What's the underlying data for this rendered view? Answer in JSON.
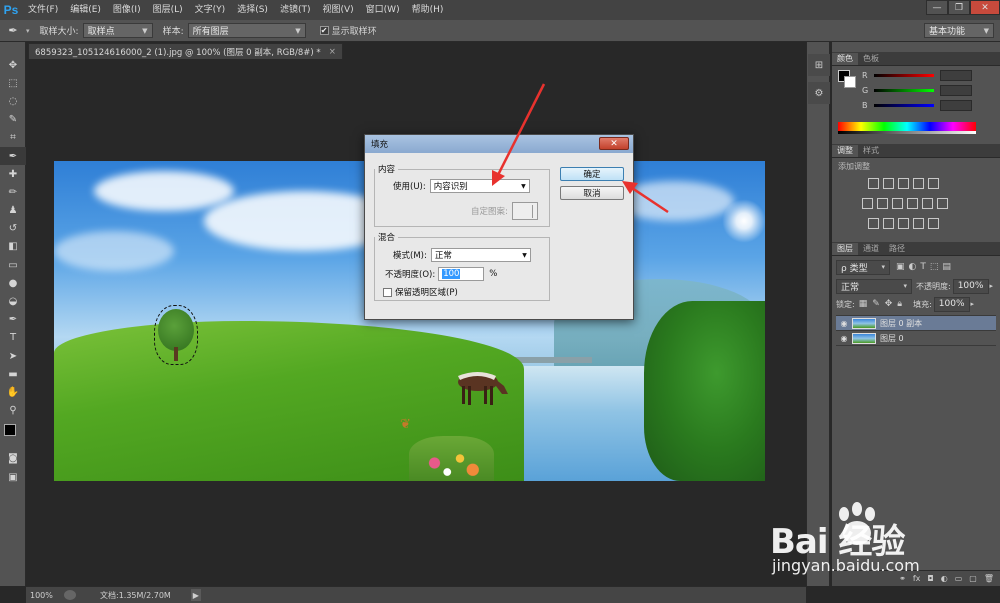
{
  "app": {
    "logo": "Ps",
    "menu": [
      "文件(F)",
      "编辑(E)",
      "图像(I)",
      "图层(L)",
      "文字(Y)",
      "选择(S)",
      "滤镜(T)",
      "视图(V)",
      "窗口(W)",
      "帮助(H)"
    ],
    "window_buttons": [
      "—",
      "❐",
      "✕"
    ]
  },
  "options": {
    "sample_size_label": "取样大小:",
    "sample_size_value": "取样点",
    "sample_label": "样本:",
    "sample_value": "所有图层",
    "show_ring_label": "显示取样环",
    "workspace": "基本功能"
  },
  "document": {
    "tab_title": "6859323_105124616000_2 (1).jpg @ 100% (图层 0 副本, RGB/8#) *",
    "tab_close": "×"
  },
  "status": {
    "zoom": "100%",
    "doc_info": "文档:1.35M/2.70M"
  },
  "panels": {
    "color_tabs": [
      "颜色",
      "色板"
    ],
    "channels": [
      "R",
      "G",
      "B"
    ],
    "adjust_tabs": [
      "调整",
      "样式"
    ],
    "adjust_title": "添加调整",
    "layer_tabs": [
      "图层",
      "通道",
      "路径"
    ],
    "filter_kind": "ρ 类型",
    "blend_mode": "正常",
    "opacity_label": "不透明度:",
    "opacity_value": "100%",
    "lock_label": "锁定:",
    "fill_label": "填充:",
    "fill_value": "100%",
    "layers": [
      {
        "name": "图层 0 副本",
        "active": true
      },
      {
        "name": "图层 0",
        "active": false
      }
    ]
  },
  "dialog": {
    "title": "填充",
    "close": "✕",
    "content_group": "内容",
    "use_label": "使用(U):",
    "use_value": "内容识别",
    "custom_pattern_label": "自定图案:",
    "blend_group": "混合",
    "mode_label": "模式(M):",
    "mode_value": "正常",
    "opacity_label": "不透明度(O):",
    "opacity_value": "100",
    "opacity_unit": "%",
    "preserve_label": "保留透明区域(P)",
    "ok": "确定",
    "cancel": "取消"
  },
  "watermark": {
    "main": "Bai 经验",
    "sub": "jingyan.baidu.com"
  },
  "colors": {
    "accent_arrow": "#e8322e",
    "ps_blue": "#2fa3f1"
  }
}
